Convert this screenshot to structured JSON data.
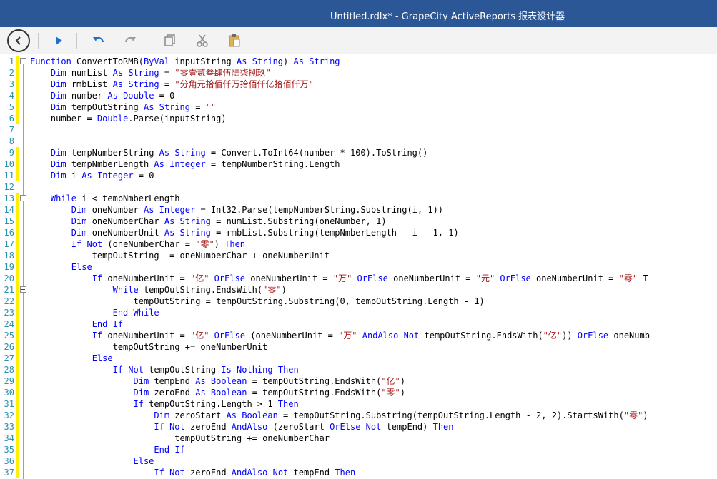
{
  "window": {
    "title": "Untitled.rdlx* - GrapeCity ActiveReports 报表设计器"
  },
  "toolbar": {
    "buttons": [
      {
        "name": "back-button",
        "icon": "back-arrow-icon"
      },
      {
        "name": "run-button",
        "icon": "play-icon"
      },
      {
        "name": "undo-button",
        "icon": "undo-icon"
      },
      {
        "name": "redo-button",
        "icon": "redo-icon"
      },
      {
        "name": "copy-button",
        "icon": "copy-icon"
      },
      {
        "name": "cut-button",
        "icon": "scissors-icon"
      },
      {
        "name": "paste-button",
        "icon": "paste-icon"
      }
    ]
  },
  "colors": {
    "titlebar": "#2b5797",
    "keyword": "#0000ff",
    "string": "#a31515",
    "type": "#2b91af",
    "line_number": "#2b91af",
    "change_marker": "#ffef00"
  },
  "editor": {
    "line_numbers": [
      "1",
      "2",
      "3",
      "4",
      "5",
      "6",
      "7",
      "8",
      "9",
      "10",
      "11",
      "12",
      "13",
      "14",
      "15",
      "16",
      "17",
      "18",
      "19",
      "20",
      "21",
      "22",
      "23",
      "24",
      "25",
      "26",
      "27",
      "28",
      "29",
      "30",
      "31",
      "32",
      "33",
      "34",
      "35",
      "36",
      "37"
    ],
    "lines": [
      [
        [
          "k",
          "Function"
        ],
        [
          "p",
          " ConvertToRMB("
        ],
        [
          "k",
          "ByVal"
        ],
        [
          "p",
          " inputString "
        ],
        [
          "k",
          "As"
        ],
        [
          "p",
          " "
        ],
        [
          "k",
          "String"
        ],
        [
          "p",
          ") "
        ],
        [
          "k",
          "As"
        ],
        [
          "p",
          " "
        ],
        [
          "k",
          "String"
        ]
      ],
      [
        [
          "p",
          "    "
        ],
        [
          "k",
          "Dim"
        ],
        [
          "p",
          " numList "
        ],
        [
          "k",
          "As"
        ],
        [
          "p",
          " "
        ],
        [
          "k",
          "String"
        ],
        [
          "p",
          " = "
        ],
        [
          "s",
          "\"零壹贰叁肆伍陆柒捌玖\""
        ]
      ],
      [
        [
          "p",
          "    "
        ],
        [
          "k",
          "Dim"
        ],
        [
          "p",
          " rmbList "
        ],
        [
          "k",
          "As"
        ],
        [
          "p",
          " "
        ],
        [
          "k",
          "String"
        ],
        [
          "p",
          " = "
        ],
        [
          "s",
          "\"分角元拾佰仟万拾佰仟亿拾佰仟万\""
        ]
      ],
      [
        [
          "p",
          "    "
        ],
        [
          "k",
          "Dim"
        ],
        [
          "p",
          " number "
        ],
        [
          "k",
          "As"
        ],
        [
          "p",
          " "
        ],
        [
          "k",
          "Double"
        ],
        [
          "p",
          " = 0"
        ]
      ],
      [
        [
          "p",
          "    "
        ],
        [
          "k",
          "Dim"
        ],
        [
          "p",
          " tempOutString "
        ],
        [
          "k",
          "As"
        ],
        [
          "p",
          " "
        ],
        [
          "k",
          "String"
        ],
        [
          "p",
          " = "
        ],
        [
          "s",
          "\"\""
        ]
      ],
      [
        [
          "p",
          "    number = "
        ],
        [
          "k",
          "Double"
        ],
        [
          "p",
          ".Parse(inputString)"
        ]
      ],
      [],
      [],
      [
        [
          "p",
          "    "
        ],
        [
          "k",
          "Dim"
        ],
        [
          "p",
          " tempNumberString "
        ],
        [
          "k",
          "As"
        ],
        [
          "p",
          " "
        ],
        [
          "k",
          "String"
        ],
        [
          "p",
          " = Convert.ToInt64(number * 100).ToString()"
        ]
      ],
      [
        [
          "p",
          "    "
        ],
        [
          "k",
          "Dim"
        ],
        [
          "p",
          " tempNmberLength "
        ],
        [
          "k",
          "As"
        ],
        [
          "p",
          " "
        ],
        [
          "k",
          "Integer"
        ],
        [
          "p",
          " = tempNumberString.Length"
        ]
      ],
      [
        [
          "p",
          "    "
        ],
        [
          "k",
          "Dim"
        ],
        [
          "p",
          " i "
        ],
        [
          "k",
          "As"
        ],
        [
          "p",
          " "
        ],
        [
          "k",
          "Integer"
        ],
        [
          "p",
          " = 0"
        ]
      ],
      [],
      [
        [
          "p",
          "    "
        ],
        [
          "k",
          "While"
        ],
        [
          "p",
          " i < tempNmberLength"
        ]
      ],
      [
        [
          "p",
          "        "
        ],
        [
          "k",
          "Dim"
        ],
        [
          "p",
          " oneNumber "
        ],
        [
          "k",
          "As"
        ],
        [
          "p",
          " "
        ],
        [
          "k",
          "Integer"
        ],
        [
          "p",
          " = Int32.Parse(tempNumberString.Substring(i, 1))"
        ]
      ],
      [
        [
          "p",
          "        "
        ],
        [
          "k",
          "Dim"
        ],
        [
          "p",
          " oneNumberChar "
        ],
        [
          "k",
          "As"
        ],
        [
          "p",
          " "
        ],
        [
          "k",
          "String"
        ],
        [
          "p",
          " = numList.Substring(oneNumber, 1)"
        ]
      ],
      [
        [
          "p",
          "        "
        ],
        [
          "k",
          "Dim"
        ],
        [
          "p",
          " oneNumberUnit "
        ],
        [
          "k",
          "As"
        ],
        [
          "p",
          " "
        ],
        [
          "k",
          "String"
        ],
        [
          "p",
          " = rmbList.Substring(tempNmberLength - i - 1, 1)"
        ]
      ],
      [
        [
          "p",
          "        "
        ],
        [
          "k",
          "If"
        ],
        [
          "p",
          " "
        ],
        [
          "k",
          "Not"
        ],
        [
          "p",
          " (oneNumberChar = "
        ],
        [
          "s",
          "\"零\""
        ],
        [
          "p",
          ") "
        ],
        [
          "k",
          "Then"
        ]
      ],
      [
        [
          "p",
          "            tempOutString += oneNumberChar + oneNumberUnit"
        ]
      ],
      [
        [
          "p",
          "        "
        ],
        [
          "k",
          "Else"
        ]
      ],
      [
        [
          "p",
          "            "
        ],
        [
          "k",
          "If"
        ],
        [
          "p",
          " oneNumberUnit = "
        ],
        [
          "s",
          "\"亿\""
        ],
        [
          "p",
          " "
        ],
        [
          "k",
          "OrElse"
        ],
        [
          "p",
          " oneNumberUnit = "
        ],
        [
          "s",
          "\"万\""
        ],
        [
          "p",
          " "
        ],
        [
          "k",
          "OrElse"
        ],
        [
          "p",
          " oneNumberUnit = "
        ],
        [
          "s",
          "\"元\""
        ],
        [
          "p",
          " "
        ],
        [
          "k",
          "OrElse"
        ],
        [
          "p",
          " oneNumberUnit = "
        ],
        [
          "s",
          "\"零\""
        ],
        [
          "p",
          " T"
        ]
      ],
      [
        [
          "p",
          "                "
        ],
        [
          "k",
          "While"
        ],
        [
          "p",
          " tempOutString.EndsWith("
        ],
        [
          "s",
          "\"零\""
        ],
        [
          "p",
          ")"
        ]
      ],
      [
        [
          "p",
          "                    tempOutString = tempOutString.Substring(0, tempOutString.Length - 1)"
        ]
      ],
      [
        [
          "p",
          "                "
        ],
        [
          "k",
          "End"
        ],
        [
          "p",
          " "
        ],
        [
          "k",
          "While"
        ]
      ],
      [
        [
          "p",
          "            "
        ],
        [
          "k",
          "End"
        ],
        [
          "p",
          " "
        ],
        [
          "k",
          "If"
        ]
      ],
      [
        [
          "p",
          "            "
        ],
        [
          "k",
          "If"
        ],
        [
          "p",
          " oneNumberUnit = "
        ],
        [
          "s",
          "\"亿\""
        ],
        [
          "p",
          " "
        ],
        [
          "k",
          "OrElse"
        ],
        [
          "p",
          " (oneNumberUnit = "
        ],
        [
          "s",
          "\"万\""
        ],
        [
          "p",
          " "
        ],
        [
          "k",
          "AndAlso"
        ],
        [
          "p",
          " "
        ],
        [
          "k",
          "Not"
        ],
        [
          "p",
          " tempOutString.EndsWith("
        ],
        [
          "s",
          "\"亿\""
        ],
        [
          "p",
          ")) "
        ],
        [
          "k",
          "OrElse"
        ],
        [
          "p",
          " oneNumb"
        ]
      ],
      [
        [
          "p",
          "                tempOutString += oneNumberUnit"
        ]
      ],
      [
        [
          "p",
          "            "
        ],
        [
          "k",
          "Else"
        ]
      ],
      [
        [
          "p",
          "                "
        ],
        [
          "k",
          "If"
        ],
        [
          "p",
          " "
        ],
        [
          "k",
          "Not"
        ],
        [
          "p",
          " tempOutString "
        ],
        [
          "k",
          "Is"
        ],
        [
          "p",
          " "
        ],
        [
          "k",
          "Nothing"
        ],
        [
          "p",
          " "
        ],
        [
          "k",
          "Then"
        ]
      ],
      [
        [
          "p",
          "                    "
        ],
        [
          "k",
          "Dim"
        ],
        [
          "p",
          " tempEnd "
        ],
        [
          "k",
          "As"
        ],
        [
          "p",
          " "
        ],
        [
          "k",
          "Boolean"
        ],
        [
          "p",
          " = tempOutString.EndsWith("
        ],
        [
          "s",
          "\"亿\""
        ],
        [
          "p",
          ")"
        ]
      ],
      [
        [
          "p",
          "                    "
        ],
        [
          "k",
          "Dim"
        ],
        [
          "p",
          " zeroEnd "
        ],
        [
          "k",
          "As"
        ],
        [
          "p",
          " "
        ],
        [
          "k",
          "Boolean"
        ],
        [
          "p",
          " = tempOutString.EndsWith("
        ],
        [
          "s",
          "\"零\""
        ],
        [
          "p",
          ")"
        ]
      ],
      [
        [
          "p",
          "                    "
        ],
        [
          "k",
          "If"
        ],
        [
          "p",
          " tempOutString.Length > 1 "
        ],
        [
          "k",
          "Then"
        ]
      ],
      [
        [
          "p",
          "                        "
        ],
        [
          "k",
          "Dim"
        ],
        [
          "p",
          " zeroStart "
        ],
        [
          "k",
          "As"
        ],
        [
          "p",
          " "
        ],
        [
          "k",
          "Boolean"
        ],
        [
          "p",
          " = tempOutString.Substring(tempOutString.Length - 2, 2).StartsWith("
        ],
        [
          "s",
          "\"零\""
        ],
        [
          "p",
          ")"
        ]
      ],
      [
        [
          "p",
          "                        "
        ],
        [
          "k",
          "If"
        ],
        [
          "p",
          " "
        ],
        [
          "k",
          "Not"
        ],
        [
          "p",
          " zeroEnd "
        ],
        [
          "k",
          "AndAlso"
        ],
        [
          "p",
          " (zeroStart "
        ],
        [
          "k",
          "OrElse"
        ],
        [
          "p",
          " "
        ],
        [
          "k",
          "Not"
        ],
        [
          "p",
          " tempEnd) "
        ],
        [
          "k",
          "Then"
        ]
      ],
      [
        [
          "p",
          "                            tempOutString += oneNumberChar"
        ]
      ],
      [
        [
          "p",
          "                        "
        ],
        [
          "k",
          "End"
        ],
        [
          "p",
          " "
        ],
        [
          "k",
          "If"
        ]
      ],
      [
        [
          "p",
          "                    "
        ],
        [
          "k",
          "Else"
        ]
      ],
      [
        [
          "p",
          "                        "
        ],
        [
          "k",
          "If"
        ],
        [
          "p",
          " "
        ],
        [
          "k",
          "Not"
        ],
        [
          "p",
          " zeroEnd "
        ],
        [
          "k",
          "AndAlso"
        ],
        [
          "p",
          " "
        ],
        [
          "k",
          "Not"
        ],
        [
          "p",
          " tempEnd "
        ],
        [
          "k",
          "Then"
        ]
      ]
    ]
  }
}
